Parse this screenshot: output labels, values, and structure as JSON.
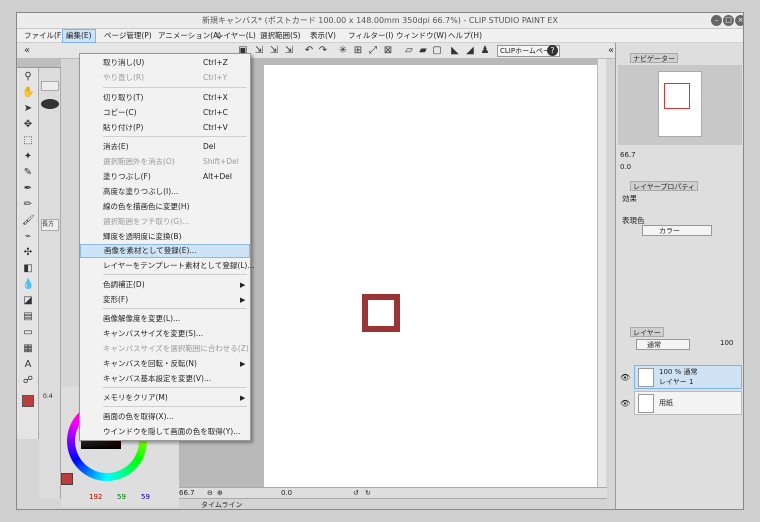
{
  "window": {
    "title": "新規キャンバス* (ポストカード 100.00 x 148.00mm 350dpi 66.7%) - CLIP STUDIO PAINT EX",
    "menu": [
      "ファイル(F)",
      "編集(E)",
      "ページ管理(P)",
      "アニメーション(A)",
      "レイヤー(L)",
      "選択範囲(S)",
      "表示(V)",
      "フィルター(I)",
      "ウィンドウ(W)",
      "ヘルプ(H)"
    ],
    "active_menu": "編集(E)"
  },
  "command_bar": {
    "clip_home": "CLIPホームページ",
    "help": "?"
  },
  "edit_menu": [
    {
      "label": "取り消し(U)",
      "shortcut": "Ctrl+Z",
      "disabled": false
    },
    {
      "label": "やり直し(R)",
      "shortcut": "Ctrl+Y",
      "disabled": true
    },
    {
      "label": "切り取り(T)",
      "shortcut": "Ctrl+X",
      "disabled": false
    },
    {
      "label": "コピー(C)",
      "shortcut": "Ctrl+C",
      "disabled": false
    },
    {
      "label": "貼り付け(P)",
      "shortcut": "Ctrl+V",
      "disabled": false
    },
    {
      "label": "消去(E)",
      "shortcut": "Del",
      "disabled": false
    },
    {
      "label": "選択範囲外を消去(O)",
      "shortcut": "Shift+Del",
      "disabled": true
    },
    {
      "label": "塗りつぶし(F)",
      "shortcut": "Alt+Del",
      "disabled": false
    },
    {
      "label": "高度な塗りつぶし(I)...",
      "shortcut": "",
      "disabled": false
    },
    {
      "label": "線の色を描画色に変更(H)",
      "shortcut": "",
      "disabled": false
    },
    {
      "label": "選択範囲をフチ取り(G)...",
      "shortcut": "",
      "disabled": true
    },
    {
      "label": "輝度を透明度に変換(B)",
      "shortcut": "",
      "disabled": false
    },
    {
      "label": "画像を素材として登録(E)...",
      "shortcut": "",
      "disabled": false,
      "highlighted": true
    },
    {
      "label": "レイヤーをテンプレート素材として登録(L)...",
      "shortcut": "",
      "disabled": false
    },
    {
      "label": "色調補正(D)",
      "shortcut": "",
      "disabled": false,
      "submenu": true
    },
    {
      "label": "変形(F)",
      "shortcut": "",
      "disabled": false,
      "submenu": true
    },
    {
      "label": "画像解像度を変更(L)...",
      "shortcut": "",
      "disabled": false
    },
    {
      "label": "キャンバスサイズを変更(S)...",
      "shortcut": "",
      "disabled": false
    },
    {
      "label": "キャンバスサイズを選択範囲に合わせる(Z)",
      "shortcut": "",
      "disabled": true
    },
    {
      "label": "キャンバスを回転・反転(N)",
      "shortcut": "",
      "disabled": false,
      "submenu": true
    },
    {
      "label": "キャンバス基本設定を変更(V)...",
      "shortcut": "",
      "disabled": false
    },
    {
      "label": "メモリをクリア(M)",
      "shortcut": "",
      "disabled": false,
      "submenu": true
    },
    {
      "label": "画面の色を取得(X)...",
      "shortcut": "",
      "disabled": false
    },
    {
      "label": "ウインドウを隠して画面の色を取得(Y)...",
      "shortcut": "",
      "disabled": false
    }
  ],
  "tool_property": {
    "label": "長方",
    "value": "0.4"
  },
  "navigator": {
    "tab": "ナビゲーター",
    "zoom": "66.7",
    "rotation": "0.0"
  },
  "layer_property": {
    "tab": "レイヤープロパティ",
    "effect": "効果",
    "expression_color": "表現色",
    "color_mode": "カラー"
  },
  "layer_panel": {
    "tab": "レイヤー",
    "blend_mode": "通常",
    "opacity": "100",
    "layers": [
      {
        "name": "100 % 通常",
        "sub": "レイヤー 1",
        "selected": true
      },
      {
        "name": "用紙",
        "sub": "",
        "selected": false
      }
    ]
  },
  "color": {
    "r": "192",
    "g": "59",
    "b": "59",
    "main": "#c03b3b"
  },
  "status": {
    "zoom": "66.7",
    "angle": "0.0"
  },
  "timeline": {
    "label": "タイムライン"
  }
}
